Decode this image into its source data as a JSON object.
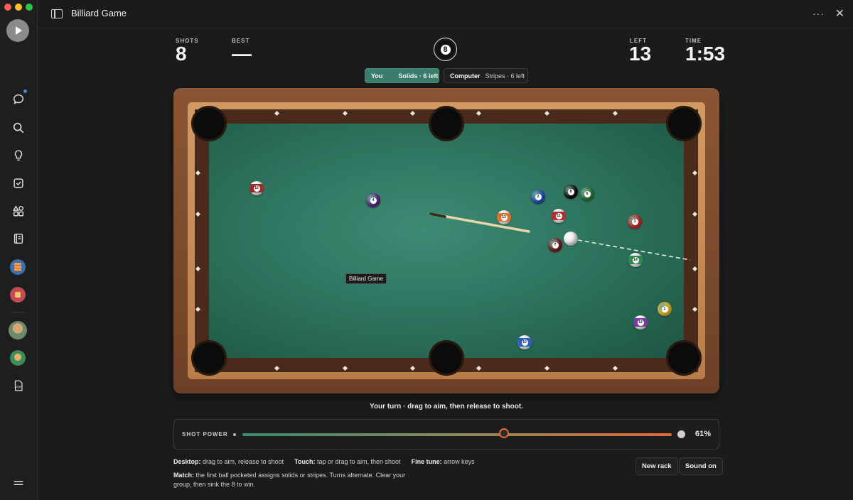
{
  "window": {
    "title": "Billiard Game"
  },
  "sidebar": {
    "icons": [
      "play-icon",
      "chat-icon",
      "search-icon",
      "lightbulb-icon",
      "checkbox-icon",
      "apps-icon",
      "notebook-icon",
      "app-stack-icon",
      "app-red-icon",
      "avatar-1",
      "avatar-2",
      "pdf-icon",
      "menu-icon"
    ]
  },
  "stats": {
    "shots_label": "SHOTS",
    "shots_value": "8",
    "best_label": "BEST",
    "best_value": "—",
    "left_label": "LEFT",
    "left_value": "13",
    "time_label": "TIME",
    "time_value": "1:53",
    "eight_ball": "8"
  },
  "players": {
    "you_name": "You",
    "you_group": "Solids · 6 left",
    "cpu_name": "Computer",
    "cpu_group": "Stripes · 6 left"
  },
  "table": {
    "tooltip": "Billiard Game",
    "balls": [
      {
        "n": "15",
        "color": "#9b2a2a",
        "stripe": true
      },
      {
        "n": "4",
        "color": "#5a2d86",
        "stripe": false
      },
      {
        "n": "13",
        "color": "#d9722b",
        "stripe": true
      },
      {
        "n": "2",
        "color": "#2455b5",
        "stripe": false
      },
      {
        "n": "8",
        "color": "#111111",
        "stripe": false
      },
      {
        "n": "6",
        "color": "#2e7a3c",
        "stripe": false
      },
      {
        "n": "11",
        "color": "#b33030",
        "stripe": true
      },
      {
        "n": "3",
        "color": "#c8322a",
        "stripe": false
      },
      {
        "n": "7",
        "color": "#7a1f1f",
        "stripe": false
      },
      {
        "n": "14",
        "color": "#2d8a4a",
        "stripe": true
      },
      {
        "n": "1",
        "color": "#e5c12a",
        "stripe": false
      },
      {
        "n": "12",
        "color": "#7a3aa0",
        "stripe": true
      },
      {
        "n": "10",
        "color": "#2a5fc0",
        "stripe": true
      }
    ]
  },
  "status": "Your turn · drag to aim, then release to shoot.",
  "power": {
    "label": "SHOT POWER",
    "value": 0.61,
    "display": "61%"
  },
  "help": {
    "desktop_label": "Desktop:",
    "desktop_text": "drag to aim, release to shoot",
    "touch_label": "Touch:",
    "touch_text": "tap or drag to aim, then shoot",
    "fine_label": "Fine tune:",
    "fine_text": "arrow keys",
    "match_label": "Match:",
    "match_text": "the first ball pocketed assigns solids or stripes. Turns alternate. Clear your group, then sink the 8 to win."
  },
  "buttons": {
    "new_rack": "New rack",
    "sound": "Sound on"
  },
  "colors": {
    "felt": "#2e7560",
    "accent": "#3a7d6a",
    "power_end": "#e0683a"
  }
}
